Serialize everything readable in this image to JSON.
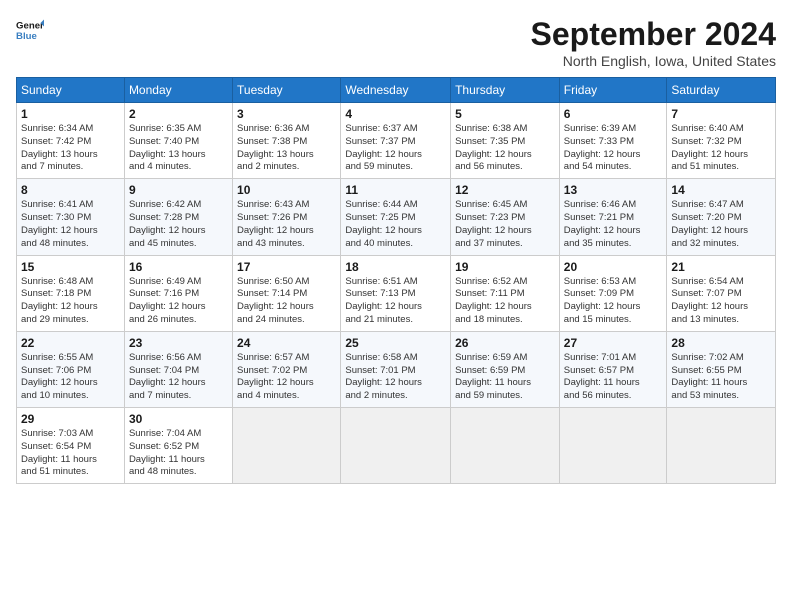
{
  "header": {
    "logo_line1": "General",
    "logo_line2": "Blue",
    "month": "September 2024",
    "location": "North English, Iowa, United States"
  },
  "weekdays": [
    "Sunday",
    "Monday",
    "Tuesday",
    "Wednesday",
    "Thursday",
    "Friday",
    "Saturday"
  ],
  "weeks": [
    [
      {
        "day": "1",
        "info": "Sunrise: 6:34 AM\nSunset: 7:42 PM\nDaylight: 13 hours\nand 7 minutes."
      },
      {
        "day": "2",
        "info": "Sunrise: 6:35 AM\nSunset: 7:40 PM\nDaylight: 13 hours\nand 4 minutes."
      },
      {
        "day": "3",
        "info": "Sunrise: 6:36 AM\nSunset: 7:38 PM\nDaylight: 13 hours\nand 2 minutes."
      },
      {
        "day": "4",
        "info": "Sunrise: 6:37 AM\nSunset: 7:37 PM\nDaylight: 12 hours\nand 59 minutes."
      },
      {
        "day": "5",
        "info": "Sunrise: 6:38 AM\nSunset: 7:35 PM\nDaylight: 12 hours\nand 56 minutes."
      },
      {
        "day": "6",
        "info": "Sunrise: 6:39 AM\nSunset: 7:33 PM\nDaylight: 12 hours\nand 54 minutes."
      },
      {
        "day": "7",
        "info": "Sunrise: 6:40 AM\nSunset: 7:32 PM\nDaylight: 12 hours\nand 51 minutes."
      }
    ],
    [
      {
        "day": "8",
        "info": "Sunrise: 6:41 AM\nSunset: 7:30 PM\nDaylight: 12 hours\nand 48 minutes."
      },
      {
        "day": "9",
        "info": "Sunrise: 6:42 AM\nSunset: 7:28 PM\nDaylight: 12 hours\nand 45 minutes."
      },
      {
        "day": "10",
        "info": "Sunrise: 6:43 AM\nSunset: 7:26 PM\nDaylight: 12 hours\nand 43 minutes."
      },
      {
        "day": "11",
        "info": "Sunrise: 6:44 AM\nSunset: 7:25 PM\nDaylight: 12 hours\nand 40 minutes."
      },
      {
        "day": "12",
        "info": "Sunrise: 6:45 AM\nSunset: 7:23 PM\nDaylight: 12 hours\nand 37 minutes."
      },
      {
        "day": "13",
        "info": "Sunrise: 6:46 AM\nSunset: 7:21 PM\nDaylight: 12 hours\nand 35 minutes."
      },
      {
        "day": "14",
        "info": "Sunrise: 6:47 AM\nSunset: 7:20 PM\nDaylight: 12 hours\nand 32 minutes."
      }
    ],
    [
      {
        "day": "15",
        "info": "Sunrise: 6:48 AM\nSunset: 7:18 PM\nDaylight: 12 hours\nand 29 minutes."
      },
      {
        "day": "16",
        "info": "Sunrise: 6:49 AM\nSunset: 7:16 PM\nDaylight: 12 hours\nand 26 minutes."
      },
      {
        "day": "17",
        "info": "Sunrise: 6:50 AM\nSunset: 7:14 PM\nDaylight: 12 hours\nand 24 minutes."
      },
      {
        "day": "18",
        "info": "Sunrise: 6:51 AM\nSunset: 7:13 PM\nDaylight: 12 hours\nand 21 minutes."
      },
      {
        "day": "19",
        "info": "Sunrise: 6:52 AM\nSunset: 7:11 PM\nDaylight: 12 hours\nand 18 minutes."
      },
      {
        "day": "20",
        "info": "Sunrise: 6:53 AM\nSunset: 7:09 PM\nDaylight: 12 hours\nand 15 minutes."
      },
      {
        "day": "21",
        "info": "Sunrise: 6:54 AM\nSunset: 7:07 PM\nDaylight: 12 hours\nand 13 minutes."
      }
    ],
    [
      {
        "day": "22",
        "info": "Sunrise: 6:55 AM\nSunset: 7:06 PM\nDaylight: 12 hours\nand 10 minutes."
      },
      {
        "day": "23",
        "info": "Sunrise: 6:56 AM\nSunset: 7:04 PM\nDaylight: 12 hours\nand 7 minutes."
      },
      {
        "day": "24",
        "info": "Sunrise: 6:57 AM\nSunset: 7:02 PM\nDaylight: 12 hours\nand 4 minutes."
      },
      {
        "day": "25",
        "info": "Sunrise: 6:58 AM\nSunset: 7:01 PM\nDaylight: 12 hours\nand 2 minutes."
      },
      {
        "day": "26",
        "info": "Sunrise: 6:59 AM\nSunset: 6:59 PM\nDaylight: 11 hours\nand 59 minutes."
      },
      {
        "day": "27",
        "info": "Sunrise: 7:01 AM\nSunset: 6:57 PM\nDaylight: 11 hours\nand 56 minutes."
      },
      {
        "day": "28",
        "info": "Sunrise: 7:02 AM\nSunset: 6:55 PM\nDaylight: 11 hours\nand 53 minutes."
      }
    ],
    [
      {
        "day": "29",
        "info": "Sunrise: 7:03 AM\nSunset: 6:54 PM\nDaylight: 11 hours\nand 51 minutes."
      },
      {
        "day": "30",
        "info": "Sunrise: 7:04 AM\nSunset: 6:52 PM\nDaylight: 11 hours\nand 48 minutes."
      },
      {
        "day": "",
        "info": ""
      },
      {
        "day": "",
        "info": ""
      },
      {
        "day": "",
        "info": ""
      },
      {
        "day": "",
        "info": ""
      },
      {
        "day": "",
        "info": ""
      }
    ]
  ]
}
